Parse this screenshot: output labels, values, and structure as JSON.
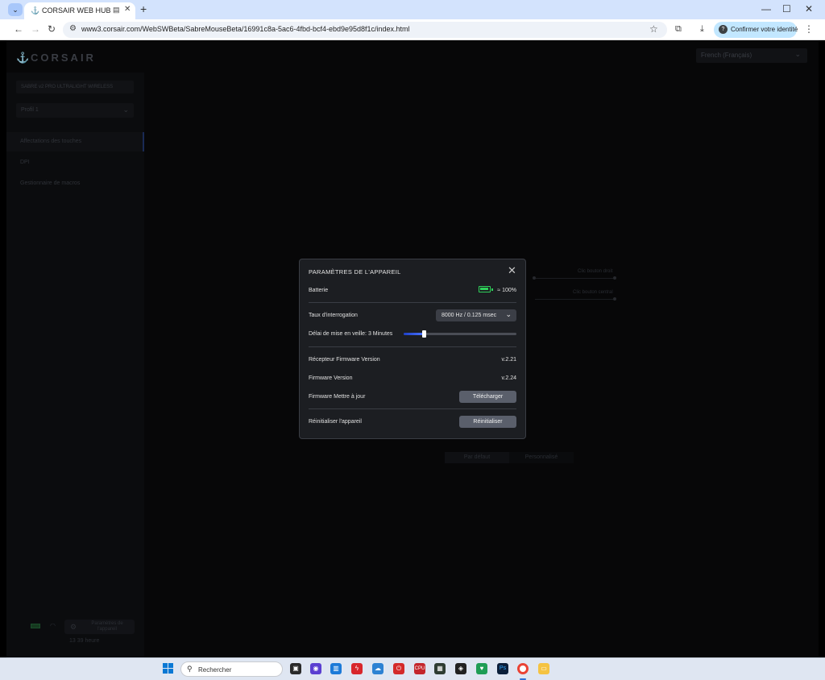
{
  "browser": {
    "tab_title": "CORSAIR WEB HUB",
    "url": "www3.corsair.com/WebSWBeta/SabreMouseBeta/16991c8a-5ac6-4fbd-bcf4-ebd9e95d8f1c/index.html",
    "identity_label": "Confirmer votre identité"
  },
  "app": {
    "logo": "CORSAIR",
    "language": "French (Français)",
    "device_name": "SABRE v2 PRO ULTRALIGHT WIRELESS",
    "profile": "Profil 1",
    "sidebar_items": [
      "Affectations des touches",
      "DPI",
      "Gestionnaire de macros"
    ],
    "device_settings_button": "Paramètres de l'appareil",
    "time_left": "13 39 heure",
    "bg_label_1": "Clic bouton droit",
    "bg_label_2": "Clic bouton central",
    "bg_btn_default": "Par défaut",
    "bg_btn_custom": "Personnalisé"
  },
  "modal": {
    "title": "PARAMÈTRES DE L'APPAREIL",
    "battery_label": "Batterie",
    "battery_value": "100%",
    "battery_prefix": "≈",
    "battery_level": 1.0,
    "polling_label": "Taux d'interrogation",
    "polling_value": "8000 Hz / 0.125 msec",
    "sleep_label": "Délai de mise en veille:",
    "sleep_value": "3 Minutes",
    "sleep_level": 0.18,
    "receiver_fw_label": "Récepteur Firmware Version",
    "receiver_fw_value": "v.2.21",
    "fw_label": "Firmware Version",
    "fw_value": "v.2.24",
    "fw_update_label": "Firmware Mettre à jour",
    "download_button": "Télécharger",
    "reset_label": "Réinitialiser l'appareil",
    "reset_button": "Réinitialiser"
  },
  "taskbar": {
    "search_placeholder": "Rechercher"
  },
  "colors": {
    "accent_blue": "#4a74ff",
    "battery_green": "#2fd15a"
  }
}
